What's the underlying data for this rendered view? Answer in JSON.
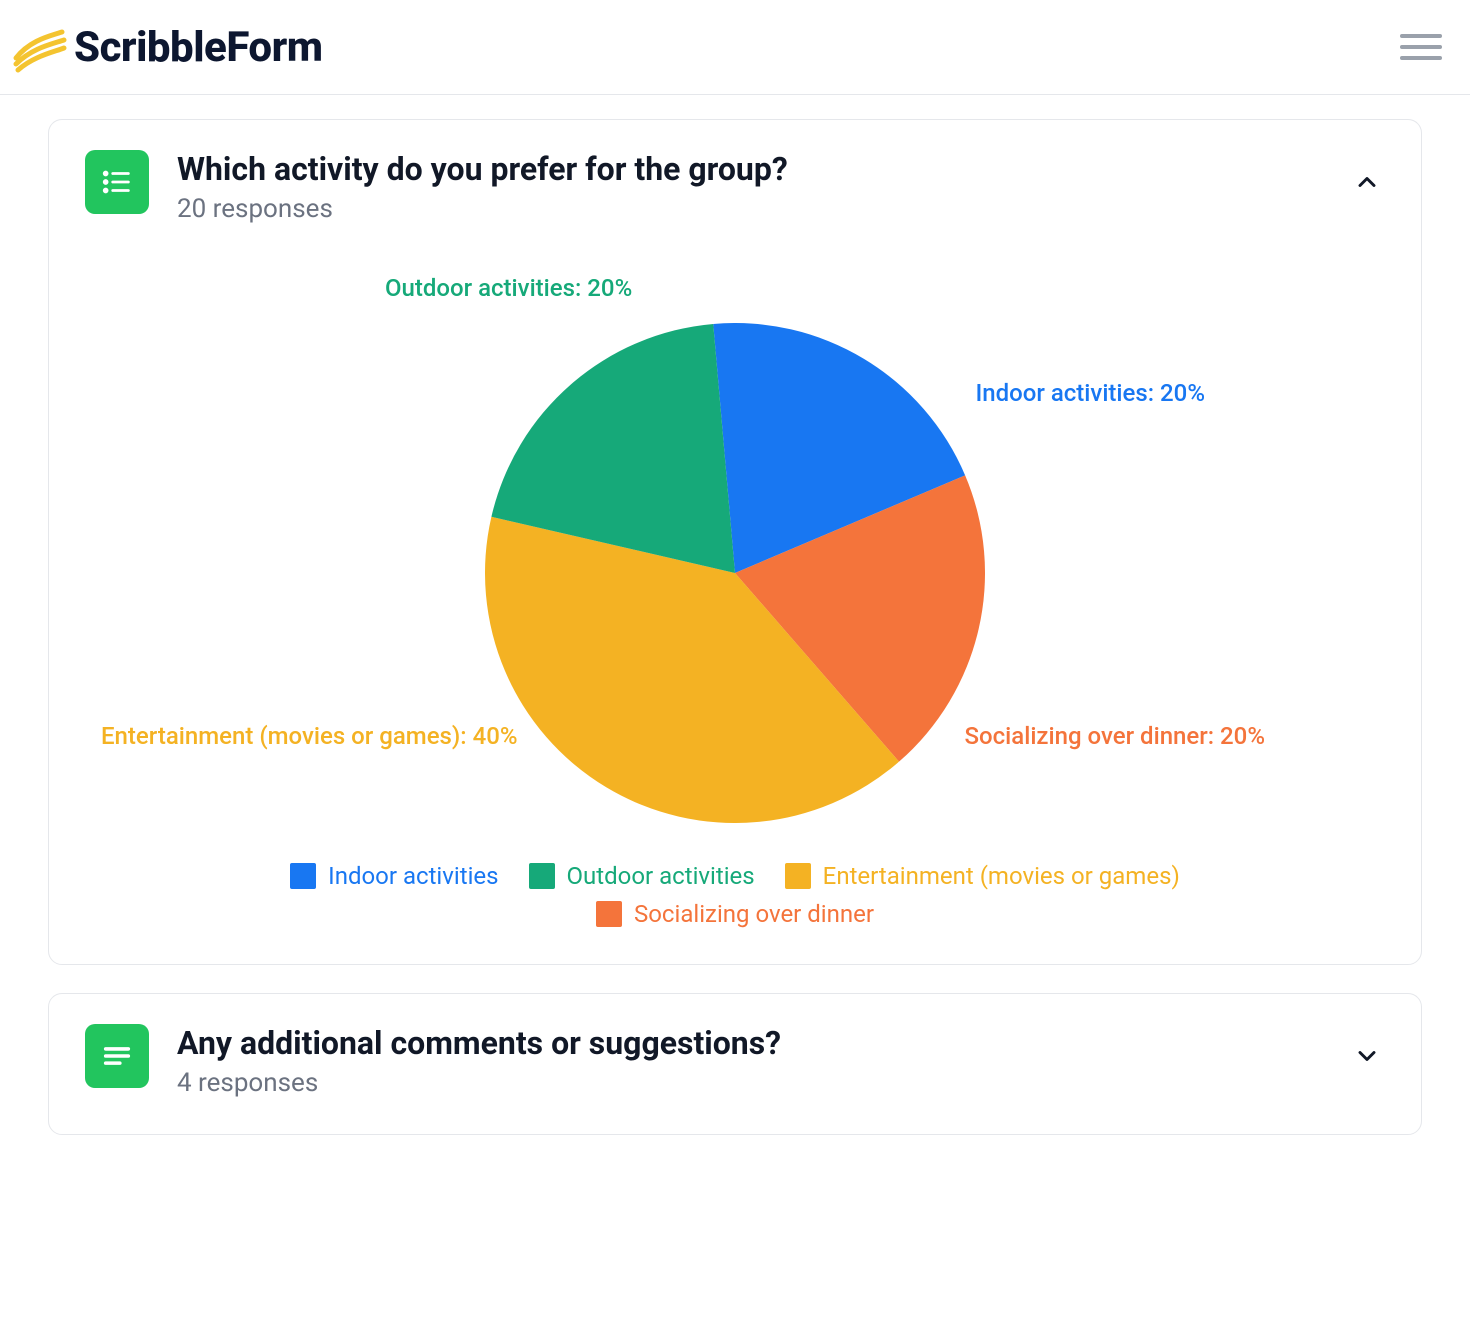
{
  "app": {
    "name": "ScribbleForm"
  },
  "questions": [
    {
      "icon": "list-icon",
      "title": "Which activity do you prefer for the group?",
      "responses_label": "20 responses",
      "expanded": true
    },
    {
      "icon": "text-icon",
      "title": "Any additional comments or suggestions?",
      "responses_label": "4 responses",
      "expanded": false
    }
  ],
  "chart_data": {
    "type": "pie",
    "title": "Which activity do you prefer for the group?",
    "series": [
      {
        "name": "Indoor activities",
        "value": 20,
        "color": "#1877f2",
        "label": "Indoor activities: 20%"
      },
      {
        "name": "Socializing over dinner",
        "value": 20,
        "color": "#f4743b",
        "label": "Socializing over dinner: 20%"
      },
      {
        "name": "Entertainment (movies or games)",
        "value": 40,
        "color": "#f4b223",
        "label": "Entertainment (movies or games): 40%"
      },
      {
        "name": "Outdoor activities",
        "value": 20,
        "color": "#16a979",
        "label": "Outdoor activities: 20%"
      }
    ],
    "legend": [
      {
        "name": "Indoor activities",
        "color": "#1877f2"
      },
      {
        "name": "Outdoor activities",
        "color": "#16a979"
      },
      {
        "name": "Entertainment (movies or games)",
        "color": "#f4b223"
      },
      {
        "name": "Socializing over dinner",
        "color": "#f4743b"
      }
    ]
  }
}
